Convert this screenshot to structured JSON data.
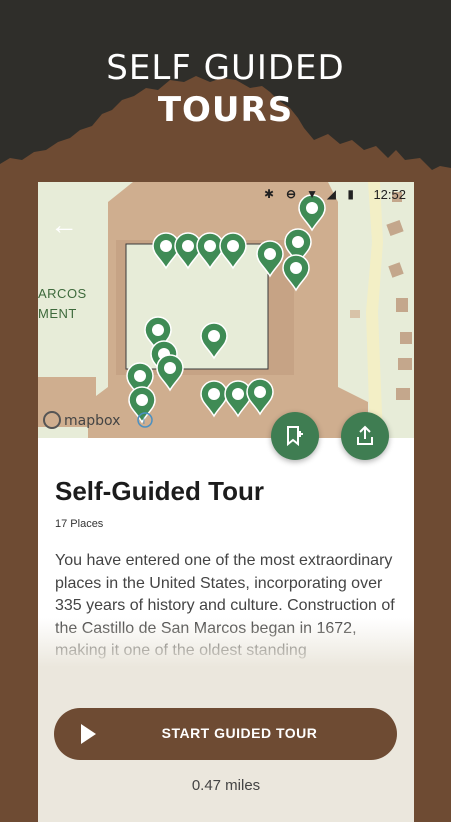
{
  "hero": {
    "line1": "SELF GUIDED",
    "line2": "TOURS"
  },
  "status_bar": {
    "time": "12:52",
    "icons": [
      "bluetooth-icon",
      "do-not-disturb-icon",
      "wifi-icon",
      "signal-icon",
      "battery-icon"
    ]
  },
  "map": {
    "labels": [
      "ARCOS",
      "MENT"
    ],
    "attribution": "mapbox",
    "marker_count": 17,
    "colors": {
      "land": "#e7ecd8",
      "fort": "#cfae8f",
      "courtyard": "#e7ecd8",
      "marker": "#3f8b55",
      "road": "#f3efc6"
    }
  },
  "actions": {
    "icons": [
      "bookmark-add-icon",
      "share-icon"
    ]
  },
  "tour": {
    "title": "Self-Guided Tour",
    "places": "17 Places",
    "description": "You have entered one of the most extraordinary places in the United States, incorporating over 335 years of history and culture. Construction of the Castillo de San Marcos began in 1672, making it one of the oldest standing"
  },
  "footer": {
    "start_label": "START GUIDED TOUR",
    "distance": "0.47 miles"
  },
  "colors": {
    "brand_brown": "#6e4b33",
    "dark_top": "#2f2e2a",
    "action_green": "#3f7d52",
    "footer_bg": "#ebe7dd"
  }
}
